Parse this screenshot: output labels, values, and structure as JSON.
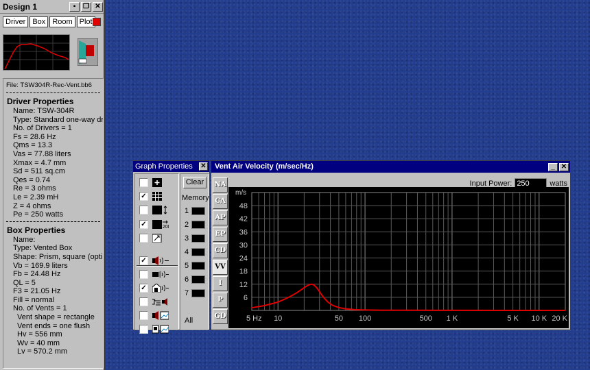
{
  "design_window": {
    "title": "Design 1",
    "tabs": [
      "Driver",
      "Box",
      "Room",
      "Plot"
    ],
    "plot_color": "#e00000",
    "file": "File: TSW304R-Rec-Vent.bb6",
    "driver_header": "Driver Properties",
    "driver_lines": [
      "Name:  TSW-304R",
      "Type: Standard one-way driver",
      "No. of Drivers = 1",
      "Fs =  28.6 Hz",
      "Qms =  13.3",
      "Vas =  77.88 liters",
      "Xmax =  4.7 mm",
      "Sd =  511 sq.cm",
      "Qes =  0.74",
      "Re =  3 ohms",
      "Le =  2.39 mH",
      "Z =  4 ohms",
      "Pe =  250 watts"
    ],
    "box_header": "Box Properties",
    "box_lines": [
      "Name:",
      "Type: Vented Box",
      "Shape: Prism, square (optimum)",
      "Vb =  169.9 liters",
      "Fb =  24.48 Hz",
      "QL =  5",
      "F3 = 21.05 Hz",
      "Fill = normal",
      "No. of Vents = 1"
    ],
    "vent_lines": [
      "Vent shape = rectangle",
      "Vent ends = one flush",
      "Hv =  556 mm",
      "Wv =  40 mm",
      "Lv =  570.2 mm"
    ]
  },
  "graph_properties": {
    "title": "Graph Properties",
    "clear_label": "Clear",
    "memory_label": "Memory",
    "memory_slots": [
      "1",
      "2",
      "3",
      "4",
      "5",
      "6",
      "7"
    ],
    "all_label": "All",
    "options_top": [
      {
        "icon": "add-icon",
        "checked": false
      },
      {
        "icon": "grid-icon",
        "checked": true
      },
      {
        "icon": "vertical-scale-icon",
        "checked": false
      },
      {
        "icon": "range-20k-icon",
        "checked": true
      },
      {
        "icon": "autoscale-icon",
        "checked": false
      }
    ],
    "options_bottom": [
      {
        "icon": "speaker-output-icon",
        "checked": true
      },
      {
        "icon": "horn-output-icon",
        "checked": false
      },
      {
        "icon": "room-output-icon",
        "checked": true
      },
      {
        "icon": "filter-icon",
        "checked": false
      },
      {
        "icon": "speaker-response-icon",
        "checked": false
      },
      {
        "icon": "monitor-response-icon",
        "checked": false
      }
    ]
  },
  "vent_window": {
    "title": "Vent Air Velocity (m/sec/Hz)",
    "side_tabs": [
      "NA",
      "CA",
      "AP",
      "EP",
      "CD",
      "VV",
      "I",
      "P",
      "GD"
    ],
    "active_tab": "VV",
    "input_power_label": "Input Power:",
    "input_power_value": "250",
    "input_power_unit": "watts"
  },
  "chart_data": {
    "type": "line",
    "title": "",
    "ylabel": "m/s",
    "xlabel": "",
    "x_scale": "log",
    "xlim": [
      5,
      20000
    ],
    "ylim": [
      0,
      54
    ],
    "y_ticks": [
      6,
      12,
      18,
      24,
      30,
      36,
      42,
      48
    ],
    "x_tick_values": [
      5,
      10,
      50,
      100,
      500,
      1000,
      5000,
      10000,
      20000
    ],
    "x_tick_labels": [
      "5 Hz",
      "10",
      "50",
      "100",
      "500",
      "1 K",
      "5 K",
      "10 K",
      "20 K"
    ],
    "grid": true,
    "line_color": "#e00000",
    "series": [
      {
        "x": [
          5,
          7,
          10,
          13,
          16,
          19,
          21,
          23,
          24.5,
          26,
          28,
          30,
          33,
          37,
          42,
          50,
          60,
          75,
          100,
          150,
          300,
          1000,
          5000,
          20000
        ],
        "y": [
          1.2,
          2.2,
          3.8,
          5.8,
          7.8,
          9.8,
          11.0,
          11.8,
          12.0,
          11.6,
          10.3,
          8.6,
          6.2,
          4.0,
          2.4,
          1.3,
          0.7,
          0.35,
          0.2,
          0.1,
          0.05,
          0.02,
          0.01,
          0.01
        ]
      }
    ]
  }
}
